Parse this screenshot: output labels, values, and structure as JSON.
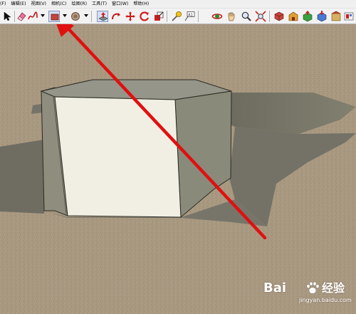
{
  "menubar": {
    "items": [
      {
        "label": "(F)"
      },
      {
        "label": "编辑(E)"
      },
      {
        "label": "视图(V)"
      },
      {
        "label": "相机(C)"
      },
      {
        "label": "绘图(R)"
      },
      {
        "label": "工具(T)"
      },
      {
        "label": "窗口(W)"
      },
      {
        "label": "帮助(H)"
      }
    ]
  },
  "toolbar": {
    "tools": [
      {
        "icon": "select-arrow-icon"
      },
      {
        "icon": "eraser-icon"
      },
      {
        "icon": "freehand-icon"
      },
      {
        "icon": "rectangle-icon"
      },
      {
        "icon": "circle-icon"
      },
      {
        "icon": "push-pull-icon"
      },
      {
        "icon": "follow-me-icon"
      },
      {
        "icon": "move-icon"
      },
      {
        "icon": "rotate-icon"
      },
      {
        "icon": "scale-icon"
      },
      {
        "icon": "tape-measure-icon"
      },
      {
        "icon": "text-icon"
      },
      {
        "icon": "orbit-icon"
      },
      {
        "icon": "pan-hand-icon"
      },
      {
        "icon": "zoom-icon"
      },
      {
        "icon": "zoom-extents-icon"
      },
      {
        "icon": "components-icon"
      }
    ],
    "text_tool_label": "A1"
  },
  "watermark": {
    "brand": "Bai",
    "brand_cn": "经验",
    "url": "jingyan.baidu.com"
  },
  "colors": {
    "ground": "#a89880",
    "shadow": "#77756a",
    "box_front": "#f1efe3",
    "box_top": "#949481",
    "box_side": "#8a8a7a",
    "annotation_arrow": "#e01010"
  }
}
